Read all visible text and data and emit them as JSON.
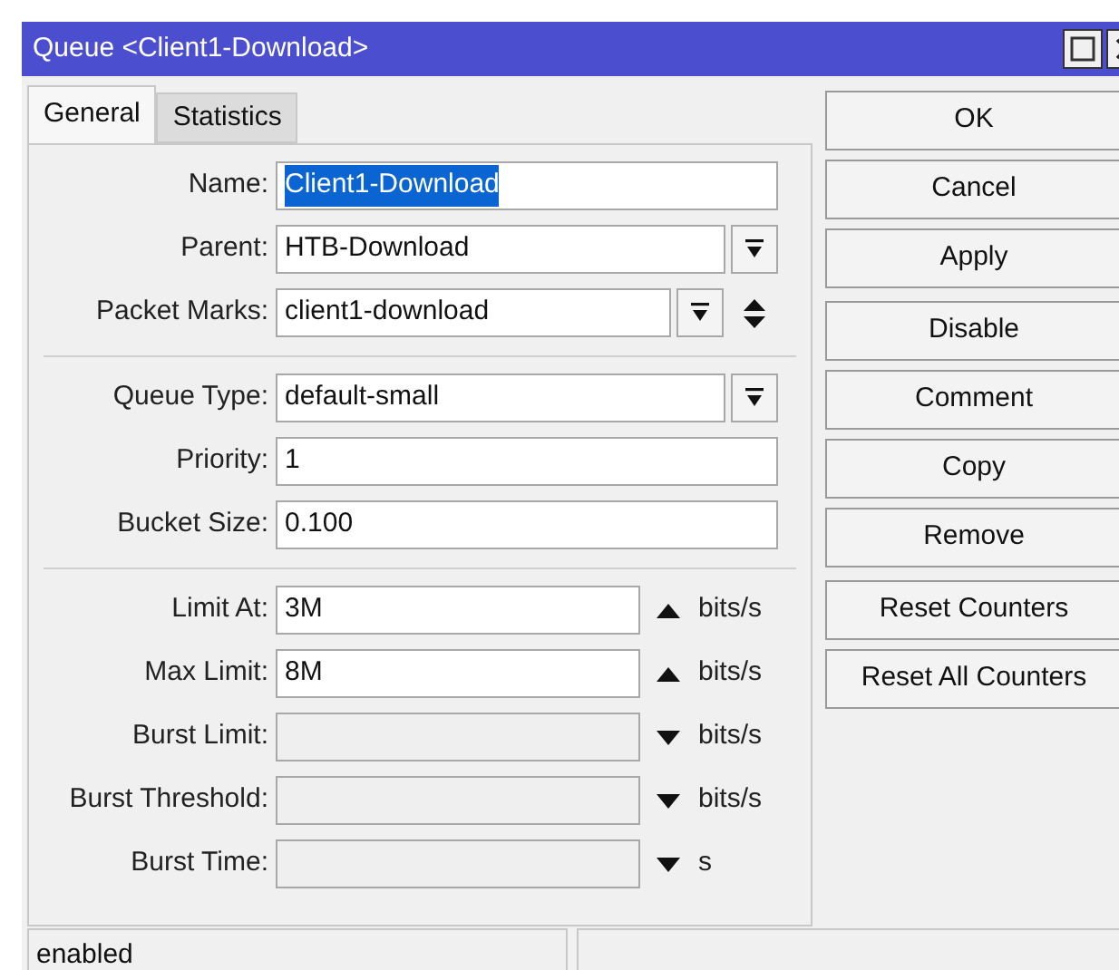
{
  "window": {
    "title": "Queue <Client1-Download>"
  },
  "tabs": [
    {
      "label": "General",
      "selected": true
    },
    {
      "label": "Statistics",
      "selected": false
    }
  ],
  "sections": [
    {
      "fields": [
        {
          "label": "Name:",
          "value": "Client1-Download",
          "kind": "text",
          "text_selected": true
        },
        {
          "label": "Parent:",
          "value": "HTB-Download",
          "kind": "dropdown"
        },
        {
          "label": "Packet Marks:",
          "value": "client1-download",
          "kind": "multi"
        }
      ]
    },
    {
      "fields": [
        {
          "label": "Queue Type:",
          "value": "default-small",
          "kind": "dropdown"
        },
        {
          "label": "Priority:",
          "value": "1",
          "kind": "text"
        },
        {
          "label": "Bucket Size:",
          "value": "0.100",
          "kind": "text"
        }
      ]
    },
    {
      "fields": [
        {
          "label": "Limit At:",
          "value": "3M",
          "kind": "toggle",
          "enabled": true,
          "unit": "bits/s"
        },
        {
          "label": "Max Limit:",
          "value": "8M",
          "kind": "toggle",
          "enabled": true,
          "unit": "bits/s"
        },
        {
          "label": "Burst Limit:",
          "kind": "toggle",
          "enabled": false,
          "unit": "bits/s"
        },
        {
          "label": "Burst Threshold:",
          "kind": "toggle",
          "enabled": false,
          "unit": "bits/s"
        },
        {
          "label": "Burst Time:",
          "kind": "toggle",
          "enabled": false,
          "unit": "s"
        }
      ]
    }
  ],
  "buttons": [
    "OK",
    "Cancel",
    "Apply",
    "Disable",
    "Comment",
    "Copy",
    "Remove",
    "Reset Counters",
    "Reset All Counters"
  ],
  "status_bar": [
    "enabled"
  ]
}
